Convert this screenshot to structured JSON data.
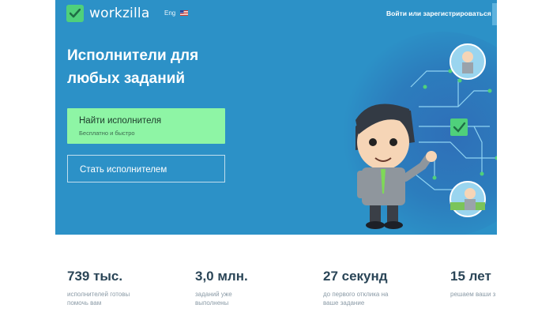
{
  "brand": {
    "name": "workzilla",
    "accent": "#4fd07b",
    "hero_bg": "#2c91c7"
  },
  "header": {
    "language": "Eng",
    "flag_icon": "us-flag-icon",
    "login_label": "Войти или зарегистрироваться"
  },
  "hero": {
    "headline_line1": "Исполнители для",
    "headline_line2": "любых заданий",
    "primary_button": {
      "title": "Найти исполнителя",
      "subtitle": "Бесплатно и быстро",
      "color": "#8ef5a5"
    },
    "secondary_button": {
      "title": "Стать исполнителем"
    }
  },
  "stats": [
    {
      "value": "739 тыс.",
      "label_line1": "исполнителей готовы",
      "label_line2": "помочь вам"
    },
    {
      "value": "3,0 млн.",
      "label_line1": "заданий уже",
      "label_line2": "выполнены"
    },
    {
      "value": "27 секунд",
      "label_line1": "до первого отклика на",
      "label_line2": "ваше задание"
    },
    {
      "value": "15 лет",
      "label_line1": "решаем ваши з",
      "label_line2": ""
    }
  ]
}
